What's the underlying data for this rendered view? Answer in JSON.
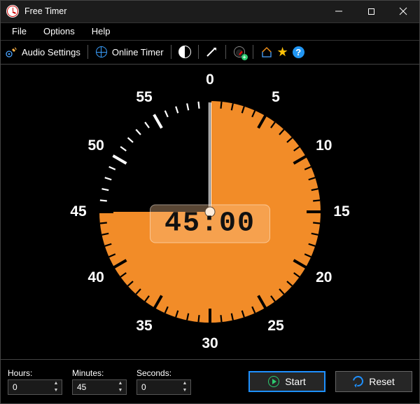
{
  "window": {
    "title": "Free Timer"
  },
  "menu": {
    "file": "File",
    "options": "Options",
    "help": "Help"
  },
  "toolbar": {
    "audio_settings": "Audio Settings",
    "online_timer": "Online Timer"
  },
  "clock": {
    "display": "45:00",
    "minutes_set": 45,
    "face_labels": [
      "0",
      "5",
      "10",
      "15",
      "20",
      "25",
      "30",
      "35",
      "40",
      "45",
      "50",
      "55"
    ],
    "colors": {
      "fill": "#f28c28",
      "ticks_on": "#000000",
      "ticks_off": "#ffffff"
    }
  },
  "inputs": {
    "hours": {
      "label": "Hours:",
      "value": "0"
    },
    "minutes": {
      "label": "Minutes:",
      "value": "45"
    },
    "seconds": {
      "label": "Seconds:",
      "value": "0"
    }
  },
  "buttons": {
    "start": "Start",
    "reset": "Reset"
  }
}
